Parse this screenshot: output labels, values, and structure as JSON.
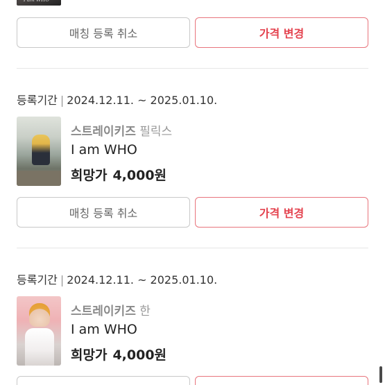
{
  "actions": {
    "cancel_label": "매칭 등록 취소",
    "price_label": "가격 변경"
  },
  "listings": [
    {
      "period_label": "등록기간",
      "period_sep": "|",
      "period_value": "2024.12.11. ~ 2025.01.10.",
      "group": "스트레이키즈",
      "member": "필릭스",
      "album": "I am WHO",
      "price_label": "희망가",
      "price_value": "4,000원"
    },
    {
      "period_label": "등록기간",
      "period_sep": "|",
      "period_value": "2024.12.11. ~ 2025.01.10.",
      "group": "스트레이키즈",
      "member": "한",
      "album": "I am WHO",
      "price_label": "희망가",
      "price_value": "4,000원"
    }
  ]
}
